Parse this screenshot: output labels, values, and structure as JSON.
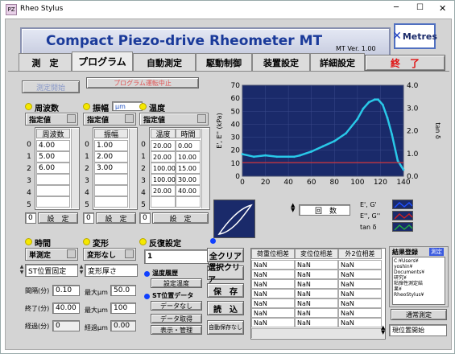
{
  "window": {
    "title": "Rheo Stylus",
    "minimize": "─",
    "maximize": "☐",
    "close": "✕"
  },
  "header": {
    "app_title": "Compact  Piezo-drive  Rheometer MT",
    "version": "MT Ver. 1.00",
    "logo": "Metres"
  },
  "tabs": [
    "測　定",
    "プログラム",
    "自動測定",
    "駆動制御",
    "装置設定",
    "詳細設定"
  ],
  "exit_label": "終　了",
  "buttons": {
    "start": "測定開始",
    "stop": "プログラム運転中止"
  },
  "frequency": {
    "title": "周波数",
    "mode": "指定値",
    "col": "周波数",
    "rows": [
      "4.00",
      "5.00",
      "6.00",
      "",
      "",
      ""
    ],
    "count": "0",
    "set": "設　定"
  },
  "amplitude": {
    "title": "振幅",
    "unit": "μm",
    "mode": "指定値",
    "col": "振幅",
    "rows": [
      "1.00",
      "2.00",
      "3.00",
      "",
      "",
      ""
    ],
    "count": "0",
    "set": "設　定"
  },
  "temperature": {
    "title": "温度",
    "mode": "指定値",
    "col1": "温度",
    "col2": "時間",
    "rows": [
      [
        "20.00",
        "0.00"
      ],
      [
        "20.00",
        "10.00"
      ],
      [
        "100.00",
        "15.00"
      ],
      [
        "100.00",
        "30.00"
      ],
      [
        "20.00",
        "40.00"
      ],
      [
        "",
        ""
      ]
    ],
    "count": "0",
    "set": "設　定"
  },
  "indices": [
    "0",
    "1",
    "2",
    "3",
    "4",
    "5"
  ],
  "chart_data": {
    "type": "line",
    "xlabel": "",
    "ylabel_left": "E', E'' (kPa)",
    "ylabel_right": "tan δ",
    "x_ticks": [
      "0",
      "20",
      "40",
      "60",
      "80",
      "100",
      "120",
      "140"
    ],
    "y_ticks_left": [
      "0",
      "10",
      "20",
      "30",
      "40",
      "50",
      "60",
      "70"
    ],
    "y_ticks_right": [
      "0.0",
      "1.0",
      "2.0",
      "3.0",
      "4.0"
    ],
    "xlim": [
      0,
      140
    ],
    "ylim_left": [
      0,
      70
    ],
    "ylim_right": [
      0,
      4
    ],
    "series": [
      {
        "color": "#29c8e8",
        "x": [
          0,
          10,
          20,
          30,
          40,
          45,
          50,
          60,
          70,
          80,
          90,
          100,
          105,
          110,
          115,
          118,
          122,
          126,
          130,
          135,
          140
        ],
        "y": [
          17,
          15,
          16,
          15,
          15,
          15,
          16,
          19,
          23,
          27,
          33,
          44,
          52,
          57,
          59,
          59,
          55,
          45,
          32,
          12,
          5
        ]
      },
      {
        "color": "#e03030",
        "x": [
          0,
          140
        ],
        "y": [
          0.6,
          0.6
        ]
      }
    ]
  },
  "chart_controls": {
    "counter_label": "回　数",
    "legend": [
      "E', G'",
      "E'', G''",
      "tan δ"
    ],
    "legend_colors": [
      "#2050ff",
      "#d02020",
      "#20b040"
    ]
  },
  "time": {
    "title": "時間",
    "mode": "単測定"
  },
  "deformation": {
    "title": "変形",
    "mode": "変形なし"
  },
  "repeat": {
    "title": "反復設定",
    "value": "1"
  },
  "st_fix": "ST位置固定",
  "deform_thick": "変形厚さ",
  "params": {
    "interval_label": "間隔(分)",
    "interval": "0.10",
    "end_label": "終了(分)",
    "end": "40.00",
    "elapsed_label": "経過(分)",
    "elapsed": "0",
    "max_label": "最大μm",
    "max": "100",
    "l50_label": "最大μm",
    "v50": "50.0",
    "elapsed2_label": "経過μm",
    "elapsed2": "0.00"
  },
  "temp_hist": {
    "label": "温度履歴",
    "btn": "設定温度"
  },
  "st_data": {
    "label": "ST位置データ",
    "btn": "データなし"
  },
  "small_btns": [
    "データ取得",
    "表示・管理"
  ],
  "side_btns": [
    "全クリア",
    "選択クリア",
    "保　存",
    "読　込"
  ],
  "auto_save": "自動保存なし",
  "result_table": {
    "headers": [
      "荷重位相差",
      "変位位相差",
      "外2位相差"
    ],
    "rows": [
      [
        "NaN",
        "NaN",
        "NaN"
      ],
      [
        "NaN",
        "NaN",
        "NaN"
      ],
      [
        "NaN",
        "NaN",
        "NaN"
      ],
      [
        "NaN",
        "NaN",
        "NaN"
      ],
      [
        "NaN",
        "NaN",
        "NaN"
      ],
      [
        "NaN",
        "NaN",
        "NaN"
      ],
      [
        "NaN",
        "NaN",
        "NaN"
      ]
    ]
  },
  "results": {
    "title": "結果登録",
    "tag": "測定",
    "path": "C:¥Users¥\nyoshin¥\nDocuments¥\n研究¥\n粘弾性測定結\n果¥\nRheoStylus¥",
    "normal": "通常測定",
    "current": "現位置開始"
  }
}
